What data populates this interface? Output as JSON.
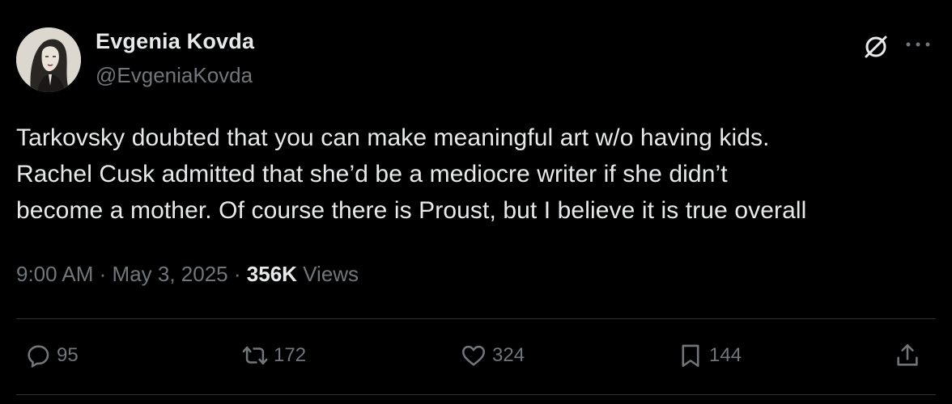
{
  "author": {
    "name": "Evgenia Kovda",
    "handle": "@EvgeniaKovda"
  },
  "tweet": {
    "lines": [
      "Tarkovsky doubted that you can make meaningful art w/o having kids.",
      "Rachel Cusk admitted that she’d be a mediocre writer if she didn’t",
      "become a mother. Of course there is Proust, but I believe it is true overall"
    ],
    "time": "9:00 AM",
    "separator": "·",
    "date": "May 3, 2025",
    "views_count": "356K",
    "views_label": "Views"
  },
  "actions": {
    "replies": "95",
    "reposts": "172",
    "likes": "324",
    "bookmarks": "144"
  },
  "icons": [
    "grok-icon",
    "more-icon",
    "reply-icon",
    "repost-icon",
    "like-icon",
    "bookmark-icon",
    "share-icon"
  ],
  "colors": {
    "background": "#000000",
    "text": "#e7e9ea",
    "muted": "#71767b",
    "divider": "#2f3336"
  }
}
